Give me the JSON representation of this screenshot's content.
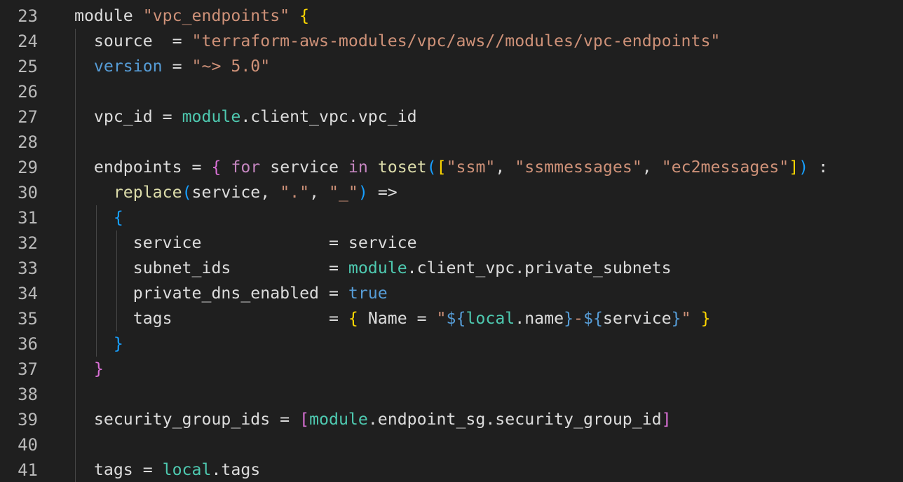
{
  "editor": {
    "language": "terraform",
    "line_number_color": "#b9b9b9",
    "background": "#1f1f1f",
    "lines": [
      {
        "number": "23",
        "tokens": [
          {
            "text": "module",
            "type": "plain"
          },
          {
            "text": " ",
            "type": "plain"
          },
          {
            "text": "\"vpc_endpoints\"",
            "type": "string"
          },
          {
            "text": " ",
            "type": "plain"
          },
          {
            "text": "{",
            "type": "brace"
          }
        ]
      },
      {
        "number": "24",
        "tokens": [
          {
            "text": "  source  = ",
            "type": "plain"
          },
          {
            "text": "\"terraform-aws-modules/vpc/aws//modules/vpc-endpoints\"",
            "type": "string"
          }
        ]
      },
      {
        "number": "25",
        "tokens": [
          {
            "text": "  ",
            "type": "plain"
          },
          {
            "text": "version",
            "type": "keyword"
          },
          {
            "text": " = ",
            "type": "plain"
          },
          {
            "text": "\"~> 5.0\"",
            "type": "string"
          }
        ]
      },
      {
        "number": "26",
        "tokens": []
      },
      {
        "number": "27",
        "tokens": [
          {
            "text": "  vpc_id = ",
            "type": "plain"
          },
          {
            "text": "module",
            "type": "type"
          },
          {
            "text": ".client_vpc.vpc_id",
            "type": "plain"
          }
        ]
      },
      {
        "number": "28",
        "tokens": []
      },
      {
        "number": "29",
        "tokens": [
          {
            "text": "  endpoints = ",
            "type": "plain"
          },
          {
            "text": "{",
            "type": "bracket2"
          },
          {
            "text": " ",
            "type": "plain"
          },
          {
            "text": "for",
            "type": "control"
          },
          {
            "text": " service ",
            "type": "plain"
          },
          {
            "text": "in",
            "type": "control"
          },
          {
            "text": " ",
            "type": "plain"
          },
          {
            "text": "toset",
            "type": "func"
          },
          {
            "text": "(",
            "type": "bracket3"
          },
          {
            "text": "[",
            "type": "brace"
          },
          {
            "text": "\"ssm\"",
            "type": "string"
          },
          {
            "text": ", ",
            "type": "plain"
          },
          {
            "text": "\"ssmmessages\"",
            "type": "string"
          },
          {
            "text": ", ",
            "type": "plain"
          },
          {
            "text": "\"ec2messages\"",
            "type": "string"
          },
          {
            "text": "]",
            "type": "brace"
          },
          {
            "text": ")",
            "type": "bracket3"
          },
          {
            "text": " :",
            "type": "plain"
          }
        ]
      },
      {
        "number": "30",
        "tokens": [
          {
            "text": "    ",
            "type": "plain"
          },
          {
            "text": "replace",
            "type": "func"
          },
          {
            "text": "(",
            "type": "bracket3"
          },
          {
            "text": "service, ",
            "type": "plain"
          },
          {
            "text": "\".\"",
            "type": "string"
          },
          {
            "text": ", ",
            "type": "plain"
          },
          {
            "text": "\"_\"",
            "type": "string"
          },
          {
            "text": ")",
            "type": "bracket3"
          },
          {
            "text": " =>",
            "type": "plain"
          }
        ]
      },
      {
        "number": "31",
        "tokens": [
          {
            "text": "    ",
            "type": "plain"
          },
          {
            "text": "{",
            "type": "bracket3"
          }
        ]
      },
      {
        "number": "32",
        "tokens": [
          {
            "text": "      service             = service",
            "type": "plain"
          }
        ]
      },
      {
        "number": "33",
        "tokens": [
          {
            "text": "      subnet_ids          = ",
            "type": "plain"
          },
          {
            "text": "module",
            "type": "type"
          },
          {
            "text": ".client_vpc.private_subnets",
            "type": "plain"
          }
        ]
      },
      {
        "number": "34",
        "tokens": [
          {
            "text": "      private_dns_enabled = ",
            "type": "plain"
          },
          {
            "text": "true",
            "type": "keyword"
          }
        ]
      },
      {
        "number": "35",
        "tokens": [
          {
            "text": "      tags                = ",
            "type": "plain"
          },
          {
            "text": "{",
            "type": "brace"
          },
          {
            "text": " Name = ",
            "type": "plain"
          },
          {
            "text": "\"",
            "type": "string"
          },
          {
            "text": "${",
            "type": "interp"
          },
          {
            "text": "local",
            "type": "type"
          },
          {
            "text": ".name",
            "type": "plain"
          },
          {
            "text": "}",
            "type": "interp"
          },
          {
            "text": "-",
            "type": "string"
          },
          {
            "text": "${",
            "type": "interp"
          },
          {
            "text": "service",
            "type": "plain"
          },
          {
            "text": "}",
            "type": "interp"
          },
          {
            "text": "\"",
            "type": "string"
          },
          {
            "text": " ",
            "type": "plain"
          },
          {
            "text": "}",
            "type": "brace"
          }
        ]
      },
      {
        "number": "36",
        "tokens": [
          {
            "text": "    ",
            "type": "plain"
          },
          {
            "text": "}",
            "type": "bracket3"
          }
        ]
      },
      {
        "number": "37",
        "tokens": [
          {
            "text": "  ",
            "type": "plain"
          },
          {
            "text": "}",
            "type": "bracket2"
          }
        ]
      },
      {
        "number": "38",
        "tokens": []
      },
      {
        "number": "39",
        "tokens": [
          {
            "text": "  security_group_ids = ",
            "type": "plain"
          },
          {
            "text": "[",
            "type": "bracket2"
          },
          {
            "text": "module",
            "type": "type"
          },
          {
            "text": ".endpoint_sg.security_group_id",
            "type": "plain"
          },
          {
            "text": "]",
            "type": "bracket2"
          }
        ]
      },
      {
        "number": "40",
        "tokens": []
      },
      {
        "number": "41",
        "tokens": [
          {
            "text": "  tags = ",
            "type": "plain"
          },
          {
            "text": "local",
            "type": "type"
          },
          {
            "text": ".tags",
            "type": "plain"
          }
        ]
      }
    ]
  }
}
